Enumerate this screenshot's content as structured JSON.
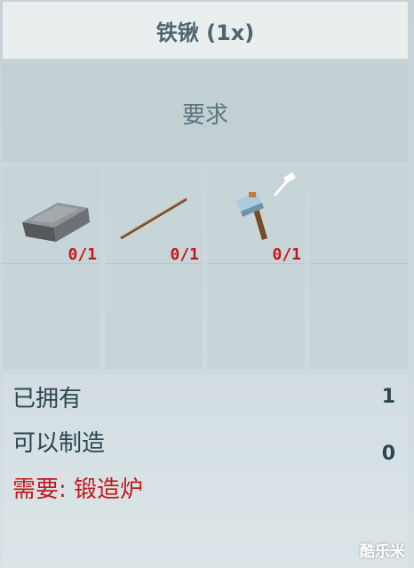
{
  "title": "铁锹 (1x)",
  "requirements": {
    "header": "要求",
    "items": [
      {
        "name": "iron-ingot-icon",
        "qty": "0/1"
      },
      {
        "name": "stick-icon",
        "qty": "0/1"
      },
      {
        "name": "hammer-icon",
        "qty": "0/1"
      },
      {
        "name": "empty-slot",
        "qty": ""
      }
    ]
  },
  "info": {
    "owned_label": "已拥有",
    "owned_value": "1",
    "craftable_label": "可以制造",
    "craftable_value": "0",
    "need_label": "需要: 锻造炉"
  },
  "watermark": "酷乐米",
  "colors": {
    "accent_red": "#c0191a",
    "text_slate": "#2c4651"
  }
}
